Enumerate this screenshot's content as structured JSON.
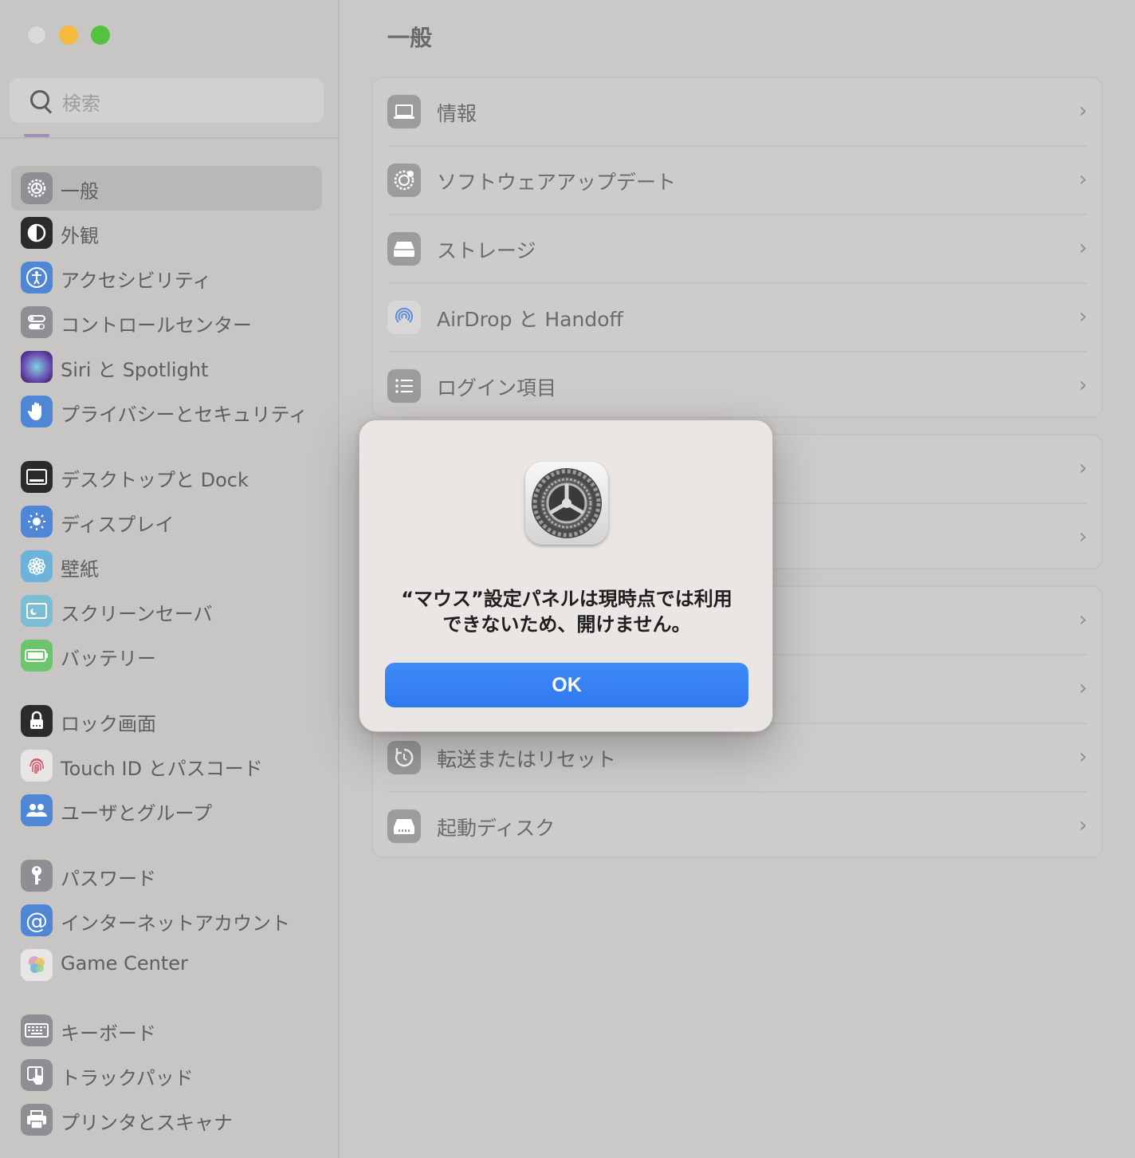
{
  "window": {
    "title": "一般",
    "controls": [
      "close",
      "minimize",
      "zoom"
    ]
  },
  "sidebar": {
    "search_placeholder": "検索",
    "items": [
      {
        "label": "一般",
        "icon": "gear-icon",
        "color": "#8e8e93",
        "selected": true
      },
      {
        "label": "外観",
        "icon": "appearance-icon",
        "color": "#1c1c1e"
      },
      {
        "label": "アクセシビリティ",
        "icon": "accessibility-icon",
        "color": "#3478f6"
      },
      {
        "label": "コントロールセンター",
        "icon": "control-center-icon",
        "color": "#8e8e93"
      },
      {
        "label": "Siri と Spotlight",
        "icon": "siri-icon",
        "color": "#5a3fa0"
      },
      {
        "label": "プライバシーとセキュリティ",
        "icon": "hand-icon",
        "color": "#3478f6"
      },
      {
        "label": "デスクトップと Dock",
        "icon": "dock-icon",
        "color": "#1c1c1e"
      },
      {
        "label": "ディスプレイ",
        "icon": "display-brightness-icon",
        "color": "#3478f6"
      },
      {
        "label": "壁紙",
        "icon": "wallpaper-flower-icon",
        "color": "#4fa9e6"
      },
      {
        "label": "スクリーンセーバ",
        "icon": "screensaver-icon",
        "color": "#5fb8d9"
      },
      {
        "label": "バッテリー",
        "icon": "battery-icon",
        "color": "#34c759"
      },
      {
        "label": "ロック画面",
        "icon": "lock-icon",
        "color": "#1c1c1e"
      },
      {
        "label": "Touch ID とパスコード",
        "icon": "fingerprint-icon",
        "color": "#f2f2f2"
      },
      {
        "label": "ユーザとグループ",
        "icon": "users-icon",
        "color": "#3478f6"
      },
      {
        "label": "パスワード",
        "icon": "key-icon",
        "color": "#8e8e93"
      },
      {
        "label": "インターネットアカウント",
        "icon": "at-sign-icon",
        "color": "#3478f6"
      },
      {
        "label": "Game Center",
        "icon": "game-center-icon",
        "color": "#f2f2f2"
      },
      {
        "label": "キーボード",
        "icon": "keyboard-icon",
        "color": "#8e8e93"
      },
      {
        "label": "トラックパッド",
        "icon": "trackpad-icon",
        "color": "#8e8e93"
      },
      {
        "label": "プリンタとスキャナ",
        "icon": "printer-icon",
        "color": "#8e8e93"
      }
    ]
  },
  "main": {
    "title": "一般",
    "groups": [
      {
        "rows": [
          {
            "label": "情報",
            "icon": "laptop-icon"
          },
          {
            "label": "ソフトウェアアップデート",
            "icon": "software-update-icon"
          },
          {
            "label": "ストレージ",
            "icon": "storage-drive-icon"
          },
          {
            "label": "AirDrop と Handoff",
            "icon": "airdrop-icon"
          },
          {
            "label": "ログイン項目",
            "icon": "list-icon"
          }
        ]
      },
      {
        "rows": [
          {
            "label": "",
            "icon": ""
          },
          {
            "label": "",
            "icon": ""
          }
        ]
      },
      {
        "rows": [
          {
            "label": "",
            "icon": ""
          },
          {
            "label": "",
            "icon": ""
          },
          {
            "label": "転送またはリセット",
            "icon": "reset-icon"
          },
          {
            "label": "起動ディスク",
            "icon": "startup-disk-icon"
          }
        ]
      }
    ]
  },
  "dialog": {
    "icon": "system-settings-gear-icon",
    "message_line1": "“マウス”設定パネルは現時点では利用",
    "message_line2": "できないため、開けません。",
    "ok_label": "OK",
    "accent_color": "#3b82f6"
  }
}
